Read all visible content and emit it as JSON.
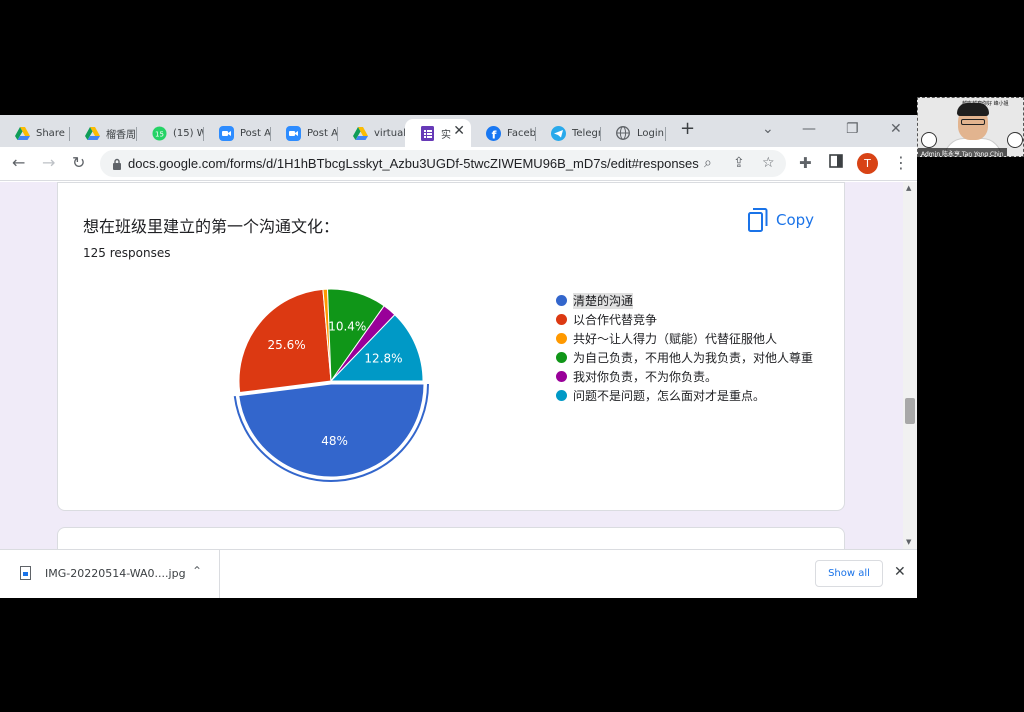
{
  "browser": {
    "tabs": [
      {
        "label": "Share",
        "icon": "google-drive-icon"
      },
      {
        "label": "榴香周",
        "icon": "google-drive-icon"
      },
      {
        "label": "(15) W",
        "icon": "whatsapp-icon",
        "badge": "15"
      },
      {
        "label": "Post A",
        "icon": "zoom-icon"
      },
      {
        "label": "Post A",
        "icon": "zoom-icon"
      },
      {
        "label": "virtual",
        "icon": "google-drive-icon"
      },
      {
        "label": "实",
        "icon": "google-forms-icon",
        "active": true
      },
      {
        "label": "Faceb",
        "icon": "facebook-icon"
      },
      {
        "label": "Telegr",
        "icon": "telegram-icon"
      },
      {
        "label": "Login",
        "icon": "globe-icon"
      }
    ],
    "new_tab": "+",
    "url": "docs.google.com/forms/d/1H1hBTbcgLsskyt_Azbu3UGDf-5twcZIWEMU96B_mD7s/edit#responses",
    "profile_initial": "T"
  },
  "form": {
    "question_title": "想在班级里建立的第一个沟通文化：",
    "response_count": "125 responses",
    "copy_label": "Copy"
  },
  "chart_data": {
    "type": "pie",
    "total_responses": 125,
    "slices": [
      {
        "label": "清楚的沟通",
        "value": 48,
        "value_label": "48%",
        "color": "#3366cc"
      },
      {
        "label": "以合作代替竞争",
        "value": 25.6,
        "value_label": "25.6%",
        "color": "#dc3912"
      },
      {
        "label": "共好～让人得力（赋能）代替征服他人",
        "value": 0.8,
        "value_label": "",
        "color": "#ff9900"
      },
      {
        "label": "为自己负责，不用他人为我负责，对他人尊重",
        "value": 10.4,
        "value_label": "10.4%",
        "color": "#109618"
      },
      {
        "label": "我对你负责，不为你负责。",
        "value": 2.4,
        "value_label": "",
        "color": "#990099"
      },
      {
        "label": "问题不是问题，怎么面对才是重点。",
        "value": 12.8,
        "value_label": "12.8%",
        "color": "#0099c6"
      }
    ],
    "highlighted_slice": "清楚的沟通",
    "legend_position": "right"
  },
  "download": {
    "filename": "IMG-20220514-WA0....jpg",
    "show_all": "Show all"
  },
  "webcam": {
    "banner": "越吃越瘦你好 峰小姐",
    "name": "Admin 陈永亨 Tan Yong Chin"
  }
}
